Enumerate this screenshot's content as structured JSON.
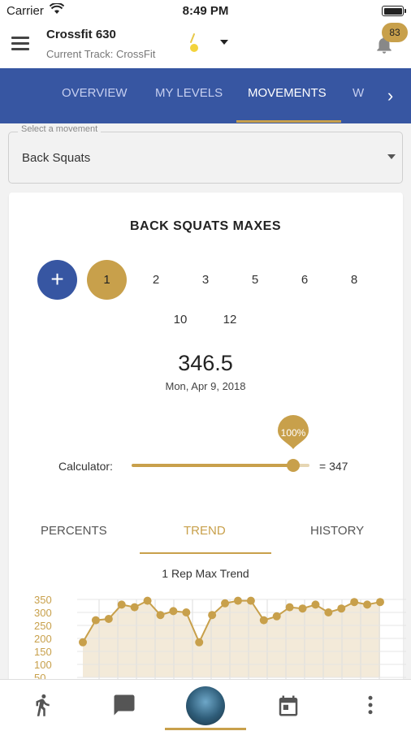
{
  "status_bar": {
    "carrier": "Carrier",
    "time": "8:49 PM"
  },
  "header": {
    "gym_name": "Crossfit 630",
    "current_track": "Current Track: CrossFit",
    "notification_count": "83"
  },
  "tabs": {
    "items": [
      {
        "label": "OVERVIEW"
      },
      {
        "label": "MY LEVELS"
      },
      {
        "label": "MOVEMENTS"
      },
      {
        "label": "W"
      }
    ],
    "active_index": 2
  },
  "movement_select": {
    "label": "Select a movement",
    "value": "Back Squats"
  },
  "maxes": {
    "title": "BACK SQUATS MAXES",
    "add_symbol": "+",
    "reps": [
      "1",
      "2",
      "3",
      "5",
      "6",
      "8",
      "10",
      "12"
    ],
    "selected_rep": "1",
    "value": "346.5",
    "date": "Mon, Apr 9, 2018"
  },
  "calculator": {
    "label": "Calculator:",
    "percent_label": "100%",
    "percent": 100,
    "result": "= 347"
  },
  "sub_tabs": {
    "items": [
      {
        "label": "PERCENTS"
      },
      {
        "label": "TREND"
      },
      {
        "label": "HISTORY"
      }
    ],
    "active_index": 1
  },
  "chart_data": {
    "type": "area",
    "title": "1 Rep Max Trend",
    "xlabel": "",
    "ylabel": "",
    "ylim": [
      50,
      350
    ],
    "yticks": [
      "350",
      "300",
      "250",
      "200",
      "150",
      "100",
      "50"
    ],
    "grid": true,
    "series": [
      {
        "values": [
          185,
          270,
          275,
          330,
          320,
          345,
          290,
          305,
          300,
          185,
          290,
          335,
          345,
          345,
          270,
          285,
          320,
          315,
          330,
          300,
          315,
          340,
          330,
          340
        ]
      }
    ]
  },
  "colors": {
    "primary": "#3756a2",
    "accent": "#c8a04b",
    "chart_fill": "#f3ead9"
  },
  "bottom_nav": {
    "icons": [
      "run-icon",
      "chat-icon",
      "profile-avatar",
      "calendar-icon",
      "more-vertical-icon"
    ]
  }
}
